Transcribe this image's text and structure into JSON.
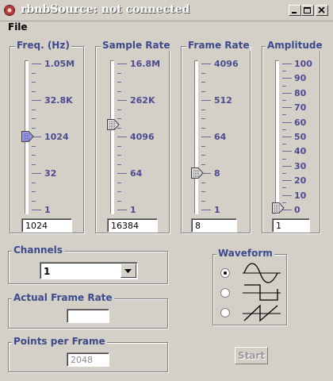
{
  "window": {
    "title": "rbnbSource: not connected"
  },
  "menu": {
    "file": "File"
  },
  "sliders": [
    {
      "label": "Freq. (Hz)",
      "ticks": [
        "1.05M",
        "32.8K",
        "1024",
        "32",
        "1"
      ],
      "value": "1024",
      "position_fraction": 0.5
    },
    {
      "label": "Sample Rate",
      "ticks": [
        "16.8M",
        "262K",
        "4096",
        "64",
        "1"
      ],
      "value": "16384",
      "position_fraction": 0.58
    },
    {
      "label": "Frame Rate",
      "ticks": [
        "4096",
        "512",
        "64",
        "8",
        "1"
      ],
      "value": "8",
      "position_fraction": 0.25
    },
    {
      "label": "Amplitude",
      "ticks": [
        "100",
        "90",
        "80",
        "70",
        "60",
        "50",
        "40",
        "30",
        "20",
        "10",
        "0"
      ],
      "value": "1",
      "position_fraction": 0.01
    }
  ],
  "channels": {
    "label": "Channels",
    "selected": "1"
  },
  "waveform": {
    "label": "Waveform",
    "options": [
      "sine-wave-icon",
      "square-wave-icon",
      "sawtooth-wave-icon"
    ],
    "selected_index": 0
  },
  "actual_frame_rate": {
    "label": "Actual Frame Rate",
    "value": ""
  },
  "points_per_frame": {
    "label": "Points per Frame",
    "value": "2048"
  },
  "start_button": {
    "label": "Start"
  }
}
